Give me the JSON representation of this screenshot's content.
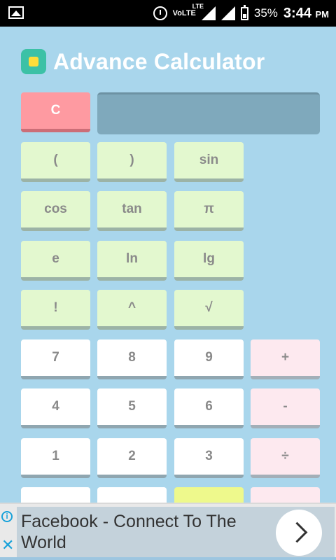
{
  "status_bar": {
    "network": "VoLTE",
    "lte": "LTE",
    "battery": "35%",
    "time": "3:44",
    "ampm": "PM"
  },
  "app": {
    "title": "Advance Calculator"
  },
  "display": {
    "value": ""
  },
  "keys": {
    "clear": "C",
    "lparen": "(",
    "rparen": ")",
    "sin": "sin",
    "cos": "cos",
    "tan": "tan",
    "pi": "π",
    "e": "e",
    "ln": "ln",
    "lg": "lg",
    "factorial": "!",
    "power": "^",
    "sqrt": "√",
    "d7": "7",
    "d8": "8",
    "d9": "9",
    "plus": "+",
    "d4": "4",
    "d5": "5",
    "d6": "6",
    "minus": "-",
    "d1": "1",
    "d2": "2",
    "d3": "3",
    "divide": "÷"
  },
  "ad": {
    "text": "Facebook - Connect To The World",
    "info": "i",
    "close": "✕"
  },
  "colors": {
    "background": "#a9d6ec",
    "function_key": "#e3f8cf",
    "digit_key": "#ffffff",
    "operator_key": "#fde9ef",
    "clear_key": "#fe9aa1",
    "display": "#7fa9bc"
  }
}
